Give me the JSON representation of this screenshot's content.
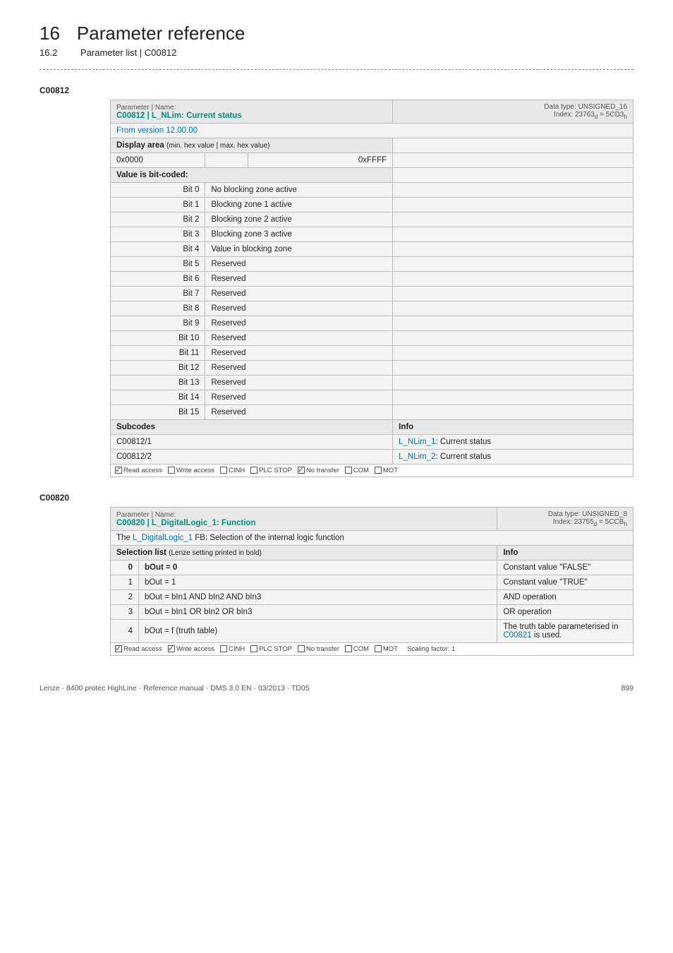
{
  "header": {
    "chapter_num": "16",
    "chapter_title": "Parameter reference",
    "sub_num": "16.2",
    "sub_title": "Parameter list | C00812"
  },
  "param1": {
    "id": "C00812",
    "name_label": "Parameter | Name:",
    "name": "C00812 | L_NLim: Current status",
    "datatype_label": "Data type: UNSIGNED_16",
    "index_label": "Index: 23763",
    "index_sub_d": "d",
    "index_eq": " = 5CD3",
    "index_sub_h": "h",
    "version": "From version 12.00.00",
    "display_area": "Display area",
    "display_area_hint": "(min. hex value | max. hex value)",
    "hex_min": "0x0000",
    "hex_max": "0xFFFF",
    "bitcoded_label": "Value is bit-coded:",
    "bits": [
      {
        "bit": "Bit 0",
        "label": "No blocking zone active"
      },
      {
        "bit": "Bit 1",
        "label": "Blocking zone 1 active"
      },
      {
        "bit": "Bit 2",
        "label": "Blocking zone 2 active"
      },
      {
        "bit": "Bit 3",
        "label": "Blocking zone 3 active"
      },
      {
        "bit": "Bit 4",
        "label": "Value in blocking zone"
      },
      {
        "bit": "Bit 5",
        "label": "Reserved"
      },
      {
        "bit": "Bit 6",
        "label": "Reserved"
      },
      {
        "bit": "Bit 7",
        "label": "Reserved"
      },
      {
        "bit": "Bit 8",
        "label": "Reserved"
      },
      {
        "bit": "Bit 9",
        "label": "Reserved"
      },
      {
        "bit": "Bit 10",
        "label": "Reserved"
      },
      {
        "bit": "Bit 11",
        "label": "Reserved"
      },
      {
        "bit": "Bit 12",
        "label": "Reserved"
      },
      {
        "bit": "Bit 13",
        "label": "Reserved"
      },
      {
        "bit": "Bit 14",
        "label": "Reserved"
      },
      {
        "bit": "Bit 15",
        "label": "Reserved"
      }
    ],
    "subcodes_label": "Subcodes",
    "info_label": "Info",
    "subcodes": [
      {
        "code": "C00812/1",
        "link": "L_NLim_1",
        "suffix": ": Current status"
      },
      {
        "code": "C00812/2",
        "link": "L_NLim_2",
        "suffix": ": Current status"
      }
    ],
    "access": {
      "read": "Read access",
      "write": "Write access",
      "cinh": "CINH",
      "plc": "PLC STOP",
      "notransfer": "No transfer",
      "com": "COM",
      "mot": "MOT"
    }
  },
  "param2": {
    "id": "C00820",
    "name_label": "Parameter | Name:",
    "name": "C00820 | L_DigitalLogic_1: Function",
    "datatype_label": "Data type: UNSIGNED_8",
    "index_label": "Index: 23755",
    "index_sub_d": "d",
    "index_eq": " = 5CCB",
    "index_sub_h": "h",
    "desc_prefix": "The ",
    "desc_link": "L_DigitalLogic_1",
    "desc_suffix": " FB: Selection of the internal logic function",
    "sel_label": "Selection list",
    "sel_hint": "(Lenze setting printed in bold)",
    "info_label": "Info",
    "rows": [
      {
        "n": "0",
        "opt": "bOut = 0",
        "bold": true,
        "info_plain": "Constant value \"FALSE\""
      },
      {
        "n": "1",
        "opt": "bOut = 1",
        "bold": false,
        "info_plain": "Constant value \"TRUE\""
      },
      {
        "n": "2",
        "opt": "bOut = bIn1 AND bIn2 AND bIn3",
        "bold": false,
        "info_plain": "AND operation"
      },
      {
        "n": "3",
        "opt": "bOut = bIn1 OR bIn2 OR bIn3",
        "bold": false,
        "info_plain": "OR operation"
      },
      {
        "n": "4",
        "opt": "bOut = f (truth table)",
        "bold": false,
        "info_prefix": "The truth table parameterised in ",
        "info_link": "C00821",
        "info_suffix": " is used."
      }
    ],
    "access": {
      "read": "Read access",
      "write": "Write access",
      "cinh": "CINH",
      "plc": "PLC STOP",
      "notransfer": "No transfer",
      "com": "COM",
      "mot": "MOT",
      "scaling": "Scaling factor: 1"
    }
  },
  "footer": {
    "left": "Lenze · 8400 protec HighLine · Reference manual · DMS 3.0 EN · 03/2013 · TD05",
    "right": "899"
  }
}
